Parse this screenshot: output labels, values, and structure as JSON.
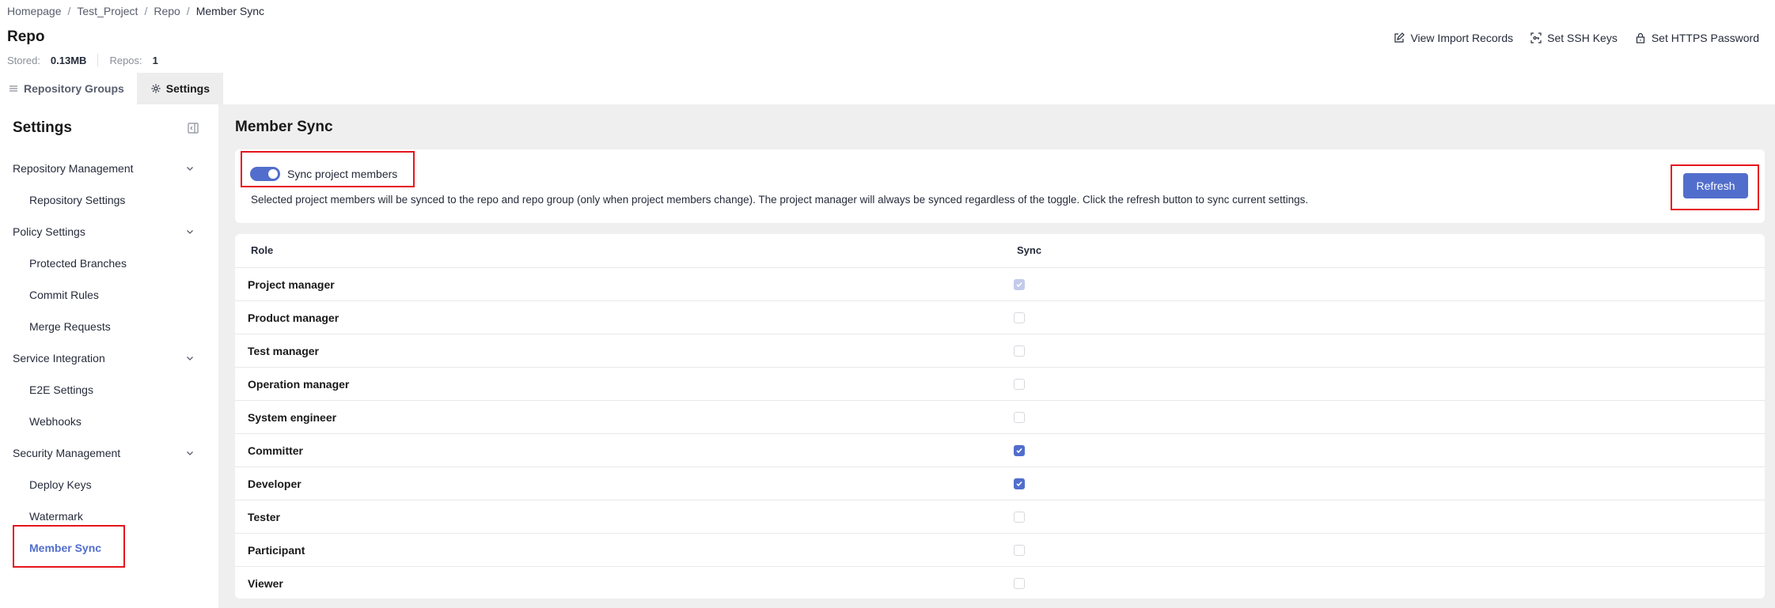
{
  "breadcrumb": [
    "Homepage",
    "Test_Project",
    "Repo",
    "Member Sync"
  ],
  "repo": {
    "title": "Repo",
    "stored_label": "Stored:",
    "stored_value": "0.13MB",
    "repos_label": "Repos:",
    "repos_value": "1"
  },
  "top_actions": {
    "view_import": "View Import Records",
    "ssh": "Set SSH Keys",
    "https": "Set HTTPS Password"
  },
  "tabs": {
    "repo_groups": "Repository Groups",
    "settings": "Settings"
  },
  "sidebar": {
    "title": "Settings",
    "groups": {
      "repo_mgmt": "Repository Management",
      "policy": "Policy Settings",
      "service": "Service Integration",
      "security": "Security Management"
    },
    "items": {
      "repo_settings": "Repository Settings",
      "protected_branches": "Protected Branches",
      "commit_rules": "Commit Rules",
      "merge_requests": "Merge Requests",
      "e2e": "E2E Settings",
      "webhooks": "Webhooks",
      "deploy_keys": "Deploy Keys",
      "watermark": "Watermark",
      "member_sync": "Member Sync"
    }
  },
  "content": {
    "title": "Member Sync",
    "toggle_label": "Sync project members",
    "toggle_on": true,
    "description": "Selected project members will be synced to the repo and repo group (only when project members change). The project manager will always be synced regardless of the toggle. Click the refresh button to sync current settings.",
    "refresh_label": "Refresh"
  },
  "table": {
    "headers": {
      "role": "Role",
      "sync": "Sync"
    },
    "rows": [
      {
        "role": "Project manager",
        "sync": true,
        "disabled": true
      },
      {
        "role": "Product manager",
        "sync": false,
        "disabled": false
      },
      {
        "role": "Test manager",
        "sync": false,
        "disabled": false
      },
      {
        "role": "Operation manager",
        "sync": false,
        "disabled": false
      },
      {
        "role": "System engineer",
        "sync": false,
        "disabled": false
      },
      {
        "role": "Committer",
        "sync": true,
        "disabled": false
      },
      {
        "role": "Developer",
        "sync": true,
        "disabled": false
      },
      {
        "role": "Tester",
        "sync": false,
        "disabled": false
      },
      {
        "role": "Participant",
        "sync": false,
        "disabled": false
      },
      {
        "role": "Viewer",
        "sync": false,
        "disabled": false
      }
    ]
  },
  "colors": {
    "accent": "#526ecc",
    "highlight": "#e6141c"
  }
}
